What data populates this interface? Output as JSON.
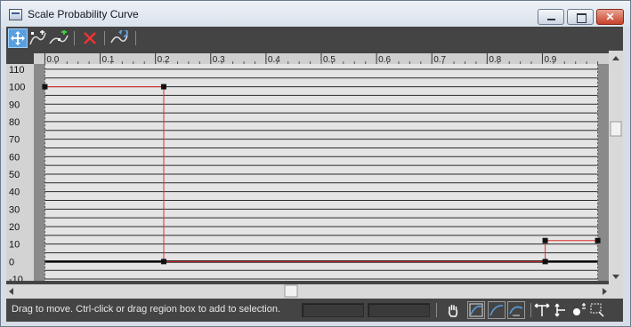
{
  "window": {
    "title": "Scale Probability Curve",
    "controls": {
      "minimize": "minimize",
      "maximize": "maximize",
      "close": "✕"
    }
  },
  "toolbar": {
    "buttons": [
      {
        "name": "move-icon",
        "active": true
      },
      {
        "name": "scale-point-icon",
        "active": false
      },
      {
        "name": "add-point-icon",
        "active": false
      },
      {
        "name": "delete-point-icon",
        "active": false
      },
      {
        "name": "reset-curve-icon",
        "active": false
      }
    ]
  },
  "chart_data": {
    "type": "line",
    "x_ticks": [
      "0.0",
      "0.1",
      "0.2",
      "0.3",
      "0.4",
      "0.5",
      "0.6",
      "0.7",
      "0.8",
      "0.9"
    ],
    "y_ticks": [
      "110",
      "100",
      "90",
      "80",
      "70",
      "60",
      "50",
      "40",
      "30",
      "20",
      "10",
      "0",
      "-10"
    ],
    "xlim": [
      0.0,
      1.0
    ],
    "ylim": [
      -10,
      110
    ],
    "grid": true,
    "series": [
      {
        "color": "#e03030",
        "points": [
          {
            "x": 0.0,
            "y": 100
          },
          {
            "x": 0.215,
            "y": 100
          },
          {
            "x": 0.215,
            "y": 0
          },
          {
            "x": 0.905,
            "y": 0
          },
          {
            "x": 0.905,
            "y": 12
          },
          {
            "x": 1.0,
            "y": 12
          }
        ]
      }
    ]
  },
  "statusbar": {
    "hint": "Drag to move. Ctrl-click or drag region box to add to selection.",
    "fields": [
      "",
      ""
    ],
    "tools": [
      "pan-hand-icon",
      "zoom-extents-icon",
      "zoom-horizontal-extents-icon",
      "zoom-value-extents-icon",
      "zoom-horizontal-icon",
      "zoom-vertical-icon",
      "zoom-icon",
      "zoom-region-icon"
    ]
  }
}
